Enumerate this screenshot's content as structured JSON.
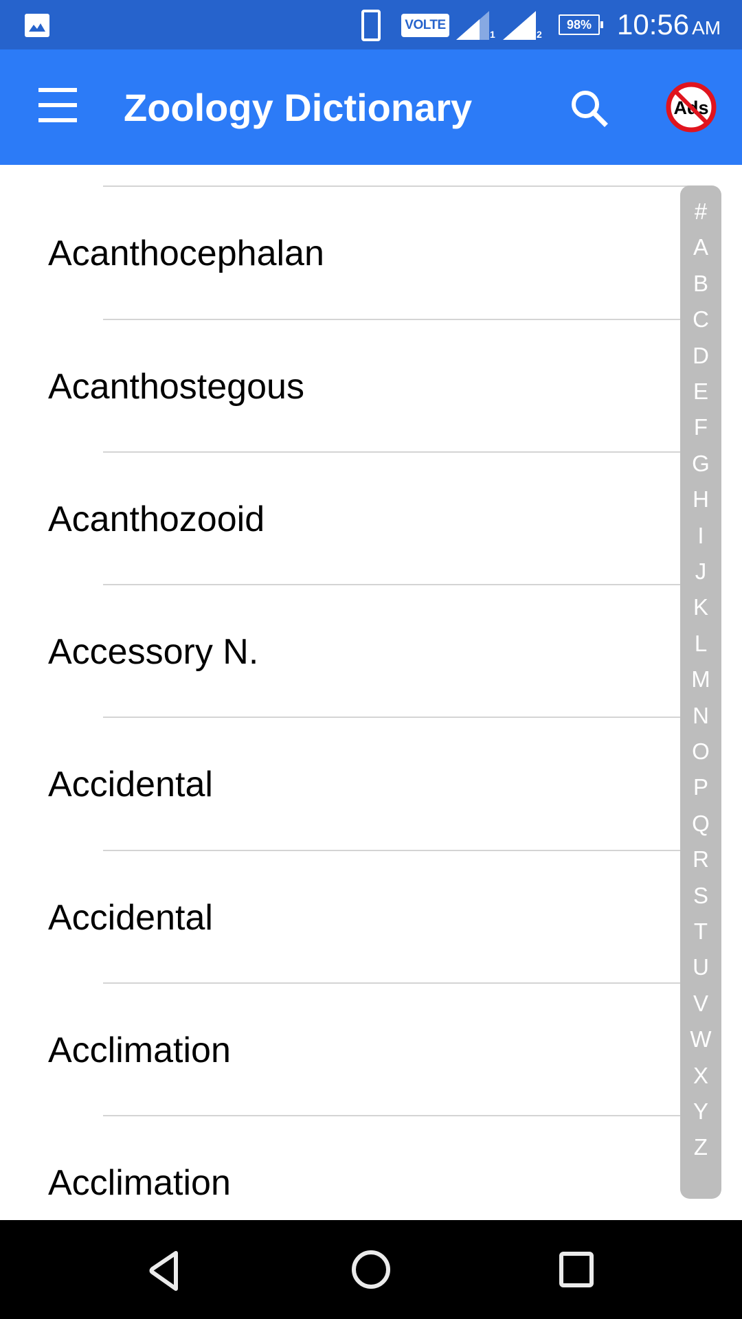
{
  "status_bar": {
    "notification_icon": "image-gallery-icon",
    "device_icon": "phone-icon",
    "volte_label": "VOLTE",
    "sim1_label": "1",
    "sim2_label": "2",
    "battery_percent": "98%",
    "time": "10:56",
    "ampm": "AM"
  },
  "app_bar": {
    "menu_icon": "hamburger-menu-icon",
    "title": "Zoology Dictionary",
    "search_icon": "search-icon",
    "remove_ads_label": "Ads",
    "remove_ads_icon": "no-ads-icon"
  },
  "list": {
    "items": [
      {
        "label": "Acanthocephalan"
      },
      {
        "label": "Acanthostegous"
      },
      {
        "label": "Acanthozooid"
      },
      {
        "label": "Accessory N."
      },
      {
        "label": "Accidental"
      },
      {
        "label": "Accidental"
      },
      {
        "label": "Acclimation"
      },
      {
        "label": "Acclimation"
      }
    ]
  },
  "alphabet_index": [
    "#",
    "A",
    "B",
    "C",
    "D",
    "E",
    "F",
    "G",
    "H",
    "I",
    "J",
    "K",
    "L",
    "M",
    "N",
    "O",
    "P",
    "Q",
    "R",
    "S",
    "T",
    "U",
    "V",
    "W",
    "X",
    "Y",
    "Z"
  ],
  "nav_bar": {
    "back_icon": "back-triangle-icon",
    "home_icon": "home-circle-icon",
    "recents_icon": "recents-square-icon"
  },
  "colors": {
    "status_bar_bg": "#2663cc",
    "app_bar_bg": "#2c7bf7",
    "index_bar_bg": "#bdbdbd",
    "ads_ring": "#e0141e"
  }
}
